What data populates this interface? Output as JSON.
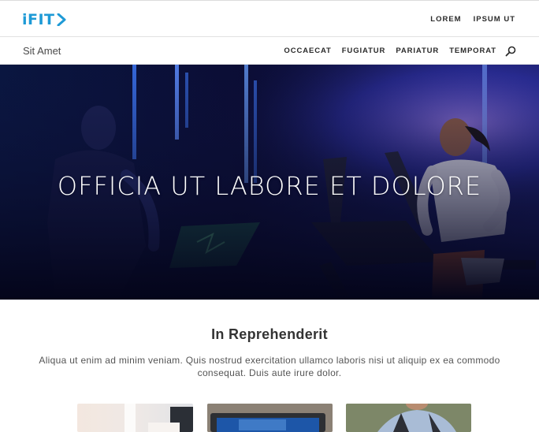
{
  "header": {
    "logo_text": "iFIT",
    "nav": [
      "LOREM",
      "IPSUM UT"
    ]
  },
  "subheader": {
    "title": "Sit Amet",
    "nav": [
      "OCCAECAT",
      "FUGIATUR",
      "PARIATUR",
      "TEMPORAT"
    ]
  },
  "hero": {
    "title": "OFFICIA UT LABORE ET DOLORE"
  },
  "intro": {
    "title": "In Reprehenderit",
    "text": "Aliqua ut enim ad minim veniam. Quis nostrud exercitation ullamco laboris nisi ut aliquip ex ea commodo consequat. Duis aute irure dolor."
  },
  "colors": {
    "brand": "#1e9ad6",
    "hero_bg": "#0a0c2a"
  },
  "icons": {
    "search": "search-icon",
    "logo_arrow": "chevron-right-icon"
  }
}
